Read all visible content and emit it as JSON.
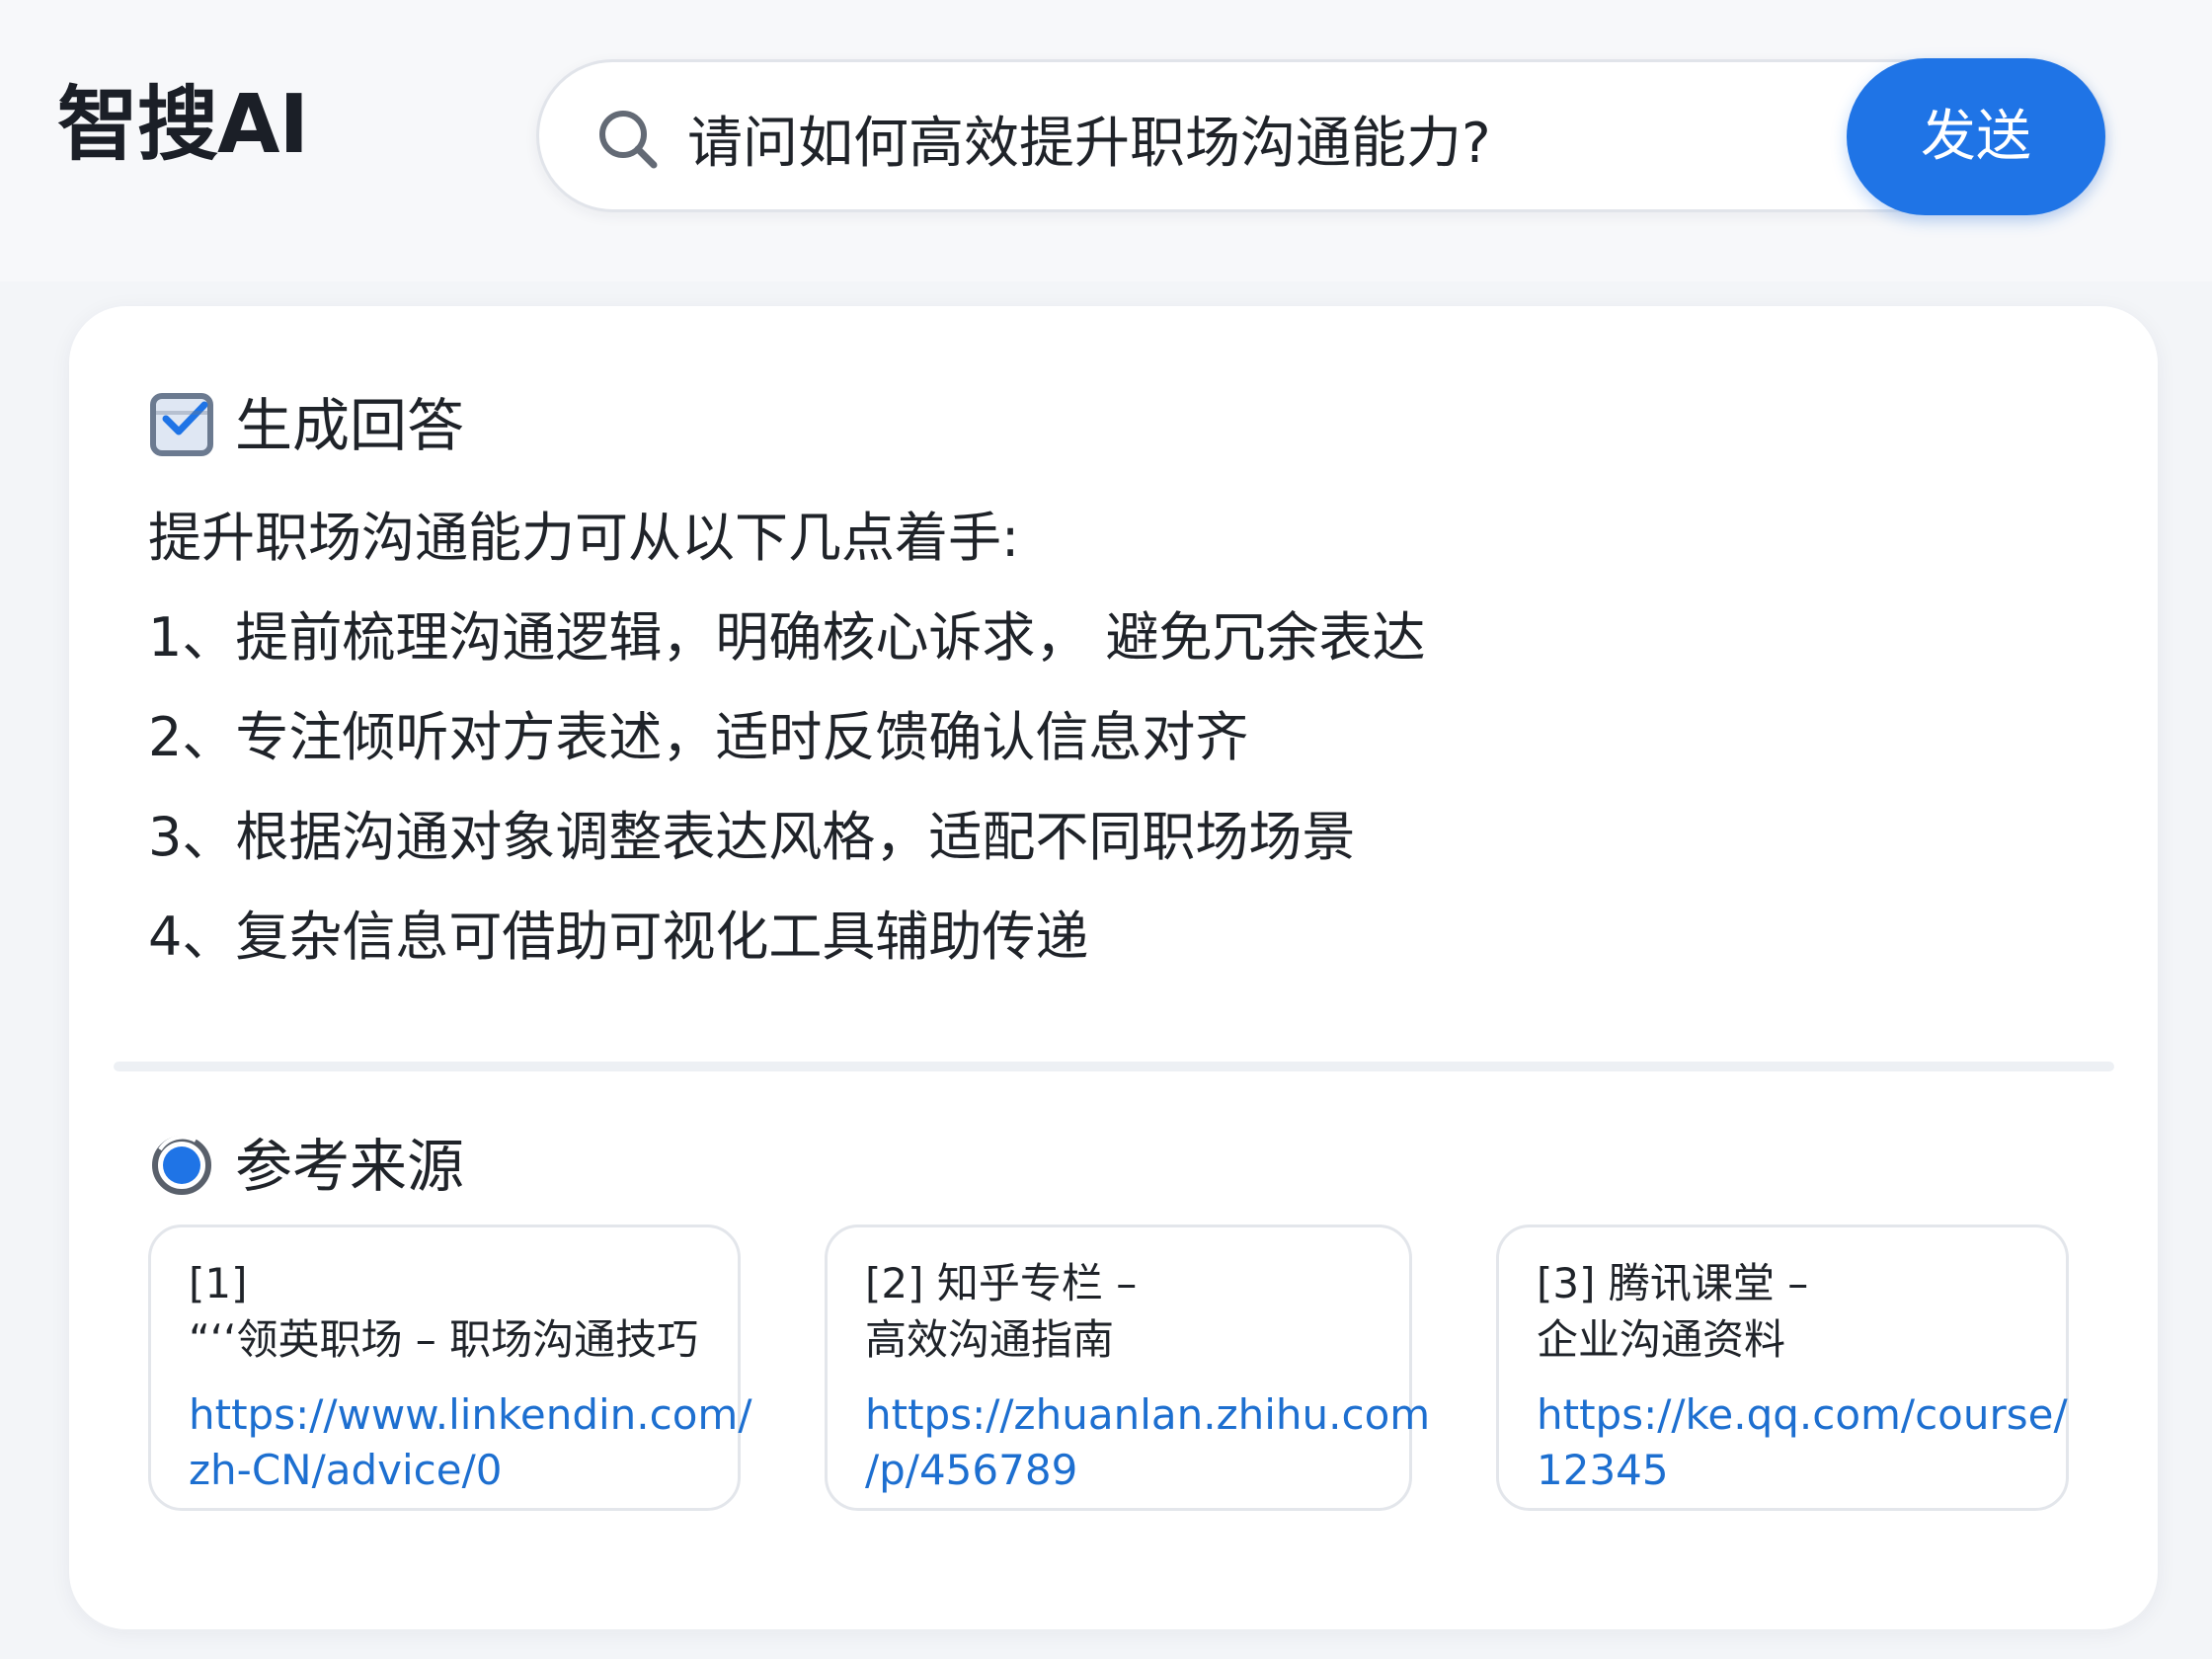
{
  "header": {
    "logo": "智搜AI",
    "search": {
      "value": "请问如何高效提升职场沟通能力?",
      "placeholder": ""
    },
    "send_label": "发送"
  },
  "answer": {
    "section_title": "生成回答",
    "intro": "提升职场沟通能力可从以下几点着手:",
    "items": [
      "1、提前梳理沟通逻辑，明确核心诉求， 避免冗余表达",
      "2、专注倾听对方表述，适时反馈确认信息对齐",
      "3、根据沟通对象调整表达风格，适配不同职场场景",
      "4、复杂信息可借助可视化工具辅助传递"
    ]
  },
  "sources": {
    "section_title": "参考来源",
    "items": [
      {
        "title": "[1]\n“‘‘领英职场 – 职场沟通技巧",
        "url": "https://www.linkendin.com/\nzh-CN/advice/0"
      },
      {
        "title": "[2] 知乎专栏 –\n高效沟通指南",
        "url": "https://zhuanlan.zhihu.com\n/p/456789"
      },
      {
        "title": "[3] 腾讯课堂 –\n企业沟通资料",
        "url": "https://ke.qq.com/course/\n12345"
      }
    ]
  },
  "colors": {
    "accent": "#1f74e6",
    "link": "#1d6fd0",
    "text": "#1f2329",
    "icon_gray": "#6b7a90"
  },
  "icons": {
    "search": "search-icon",
    "answer": "checkbox-icon",
    "sources": "source-globe-icon"
  }
}
